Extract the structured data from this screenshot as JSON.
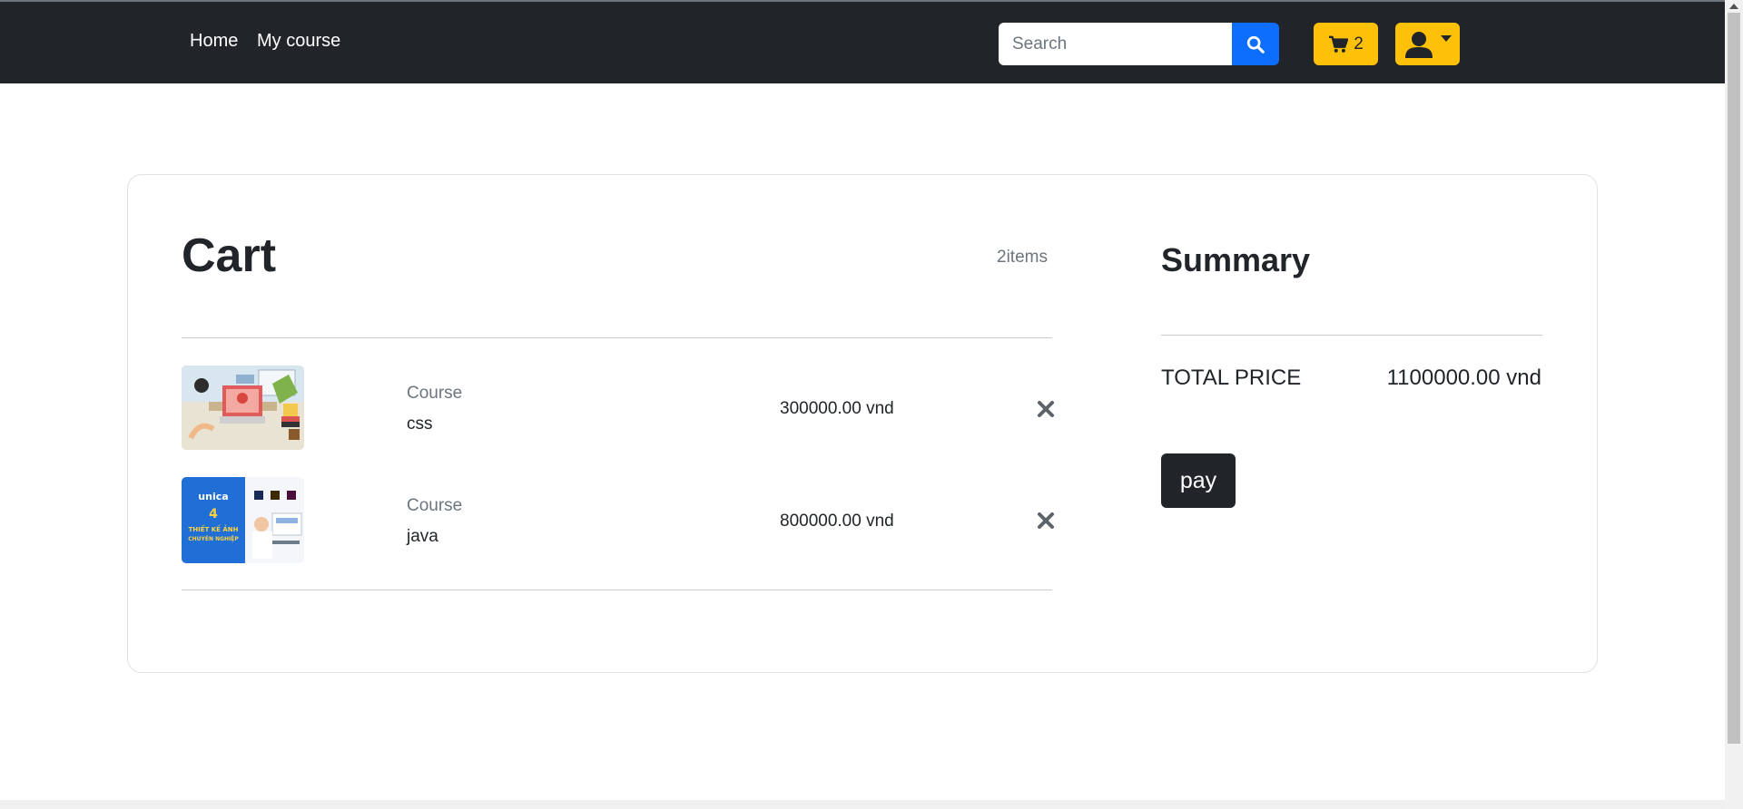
{
  "nav": {
    "home": "Home",
    "my_course": "My course",
    "search_placeholder": "Search",
    "cart_count": "2"
  },
  "cart": {
    "title": "Cart",
    "item_count": "2items",
    "items": [
      {
        "label": "Course",
        "name": "css",
        "price": "300000.00 vnd"
      },
      {
        "label": "Course",
        "name": "java",
        "price": "800000.00 vnd",
        "thumb_text": [
          "unica",
          "THIẾT KẾ ẢNH",
          "CHUYÊN NGHIỆP"
        ]
      }
    ]
  },
  "summary": {
    "title": "Summary",
    "total_label": "TOTAL PRICE",
    "total_value": "1100000.00 vnd",
    "pay_label": "pay"
  },
  "colors": {
    "navbar": "#212529",
    "search_button": "#0d6efd",
    "cart_button": "#ffc107",
    "pay_button": "#212529"
  },
  "icons": [
    "search-icon",
    "cart-icon",
    "user-icon",
    "close-icon"
  ]
}
